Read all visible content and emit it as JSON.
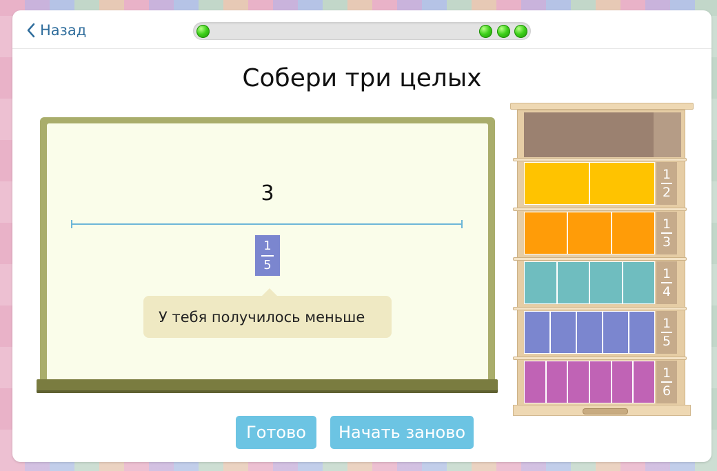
{
  "nav": {
    "back_label": "Назад"
  },
  "progress": {
    "completed_left": 1,
    "completed_right": 3
  },
  "task": {
    "title": "Собери три целых"
  },
  "board": {
    "target_number": "3",
    "piece": {
      "numerator": "1",
      "denominator": "5",
      "color": "#7b86cf"
    },
    "tooltip_text": "У тебя получилось меньше"
  },
  "buttons": {
    "done_label": "Готово",
    "restart_label": "Начать заново"
  },
  "shelf": {
    "whole_color": "#9b8170",
    "rows": [
      {
        "numerator": "1",
        "denominator": "2",
        "count": 2,
        "color": "#ffc300"
      },
      {
        "numerator": "1",
        "denominator": "3",
        "count": 3,
        "color": "#ff9c08"
      },
      {
        "numerator": "1",
        "denominator": "4",
        "count": 4,
        "color": "#6fbdbf"
      },
      {
        "numerator": "1",
        "denominator": "5",
        "count": 5,
        "color": "#7b86cf"
      },
      {
        "numerator": "1",
        "denominator": "6",
        "count": 6,
        "color": "#c063b5"
      }
    ]
  }
}
